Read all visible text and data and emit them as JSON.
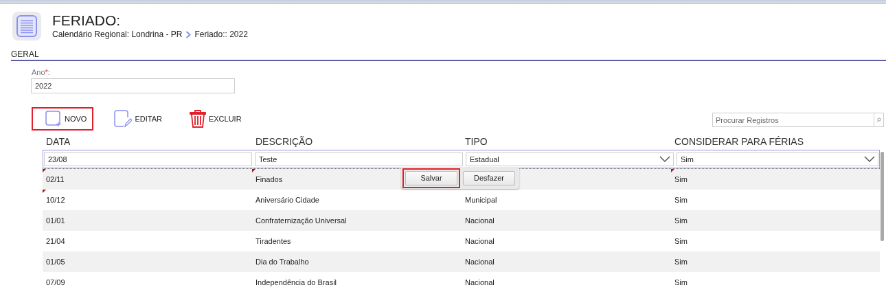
{
  "header": {
    "title": "FERIADO:",
    "breadcrumb": [
      "Calendário Regional: Londrina - PR",
      "Feriado:: 2022"
    ]
  },
  "section": {
    "title": "GERAL"
  },
  "form": {
    "label": "Ano",
    "required_mark": "*",
    "label_suffix": ":",
    "value": "2022"
  },
  "toolbar": [
    {
      "label": "NOVO",
      "kind": "new",
      "highlighted": true
    },
    {
      "label": "EDITAR",
      "kind": "edit",
      "highlighted": false
    },
    {
      "label": "EXCLUIR",
      "kind": "delete",
      "highlighted": false
    }
  ],
  "search": {
    "placeholder": "Procurar Registros"
  },
  "table": {
    "columns": [
      "DATA",
      "DESCRIÇÃO",
      "TIPO",
      "CONSIDERAR PARA FÉRIAS"
    ],
    "edit_row": [
      {
        "value": "23/08",
        "kind": "text"
      },
      {
        "value": "Teste",
        "kind": "text"
      },
      {
        "value": "Estadual",
        "kind": "select"
      },
      {
        "value": "Sim",
        "kind": "select"
      }
    ],
    "rows": [
      {
        "cells": {
          "data": {
            "text": "02/11",
            "changed": true
          },
          "descricao": {
            "text": "Finados",
            "changed": true
          },
          "considerar": {
            "text": "Sim",
            "changed": true
          }
        },
        "editor": {
          "buttons": [
            {
              "label": "Salvar",
              "highlighted": true
            },
            {
              "label": "Desfazer",
              "highlighted": false
            }
          ]
        }
      },
      {
        "cells": {
          "data": {
            "text": "10/12",
            "changed": true
          },
          "descricao": {
            "text": "Aniversário Cidade",
            "changed": false
          },
          "tipo": {
            "text": "Municipal",
            "changed": false
          },
          "considerar": {
            "text": "Sim",
            "changed": false
          }
        }
      },
      {
        "cells": {
          "data": {
            "text": "01/01",
            "changed": false
          },
          "descricao": {
            "text": "Confraternização Universal",
            "changed": false
          },
          "tipo": {
            "text": "Nacional",
            "changed": false
          },
          "considerar": {
            "text": "Sim",
            "changed": false
          }
        }
      },
      {
        "cells": {
          "data": {
            "text": "21/04",
            "changed": false
          },
          "descricao": {
            "text": "Tiradentes",
            "changed": false
          },
          "tipo": {
            "text": "Nacional",
            "changed": false
          },
          "considerar": {
            "text": "Sim",
            "changed": false
          }
        }
      },
      {
        "cells": {
          "data": {
            "text": "01/05",
            "changed": false
          },
          "descricao": {
            "text": "Dia do Trabalho",
            "changed": false
          },
          "tipo": {
            "text": "Nacional",
            "changed": false
          },
          "considerar": {
            "text": "Sim",
            "changed": false
          }
        }
      },
      {
        "cells": {
          "data": {
            "text": "07/09",
            "changed": false
          },
          "descricao": {
            "text": "Independência do Brasil",
            "changed": false
          },
          "tipo": {
            "text": "Nacional",
            "changed": false
          },
          "considerar": {
            "text": "Sim",
            "changed": false
          }
        }
      }
    ]
  }
}
